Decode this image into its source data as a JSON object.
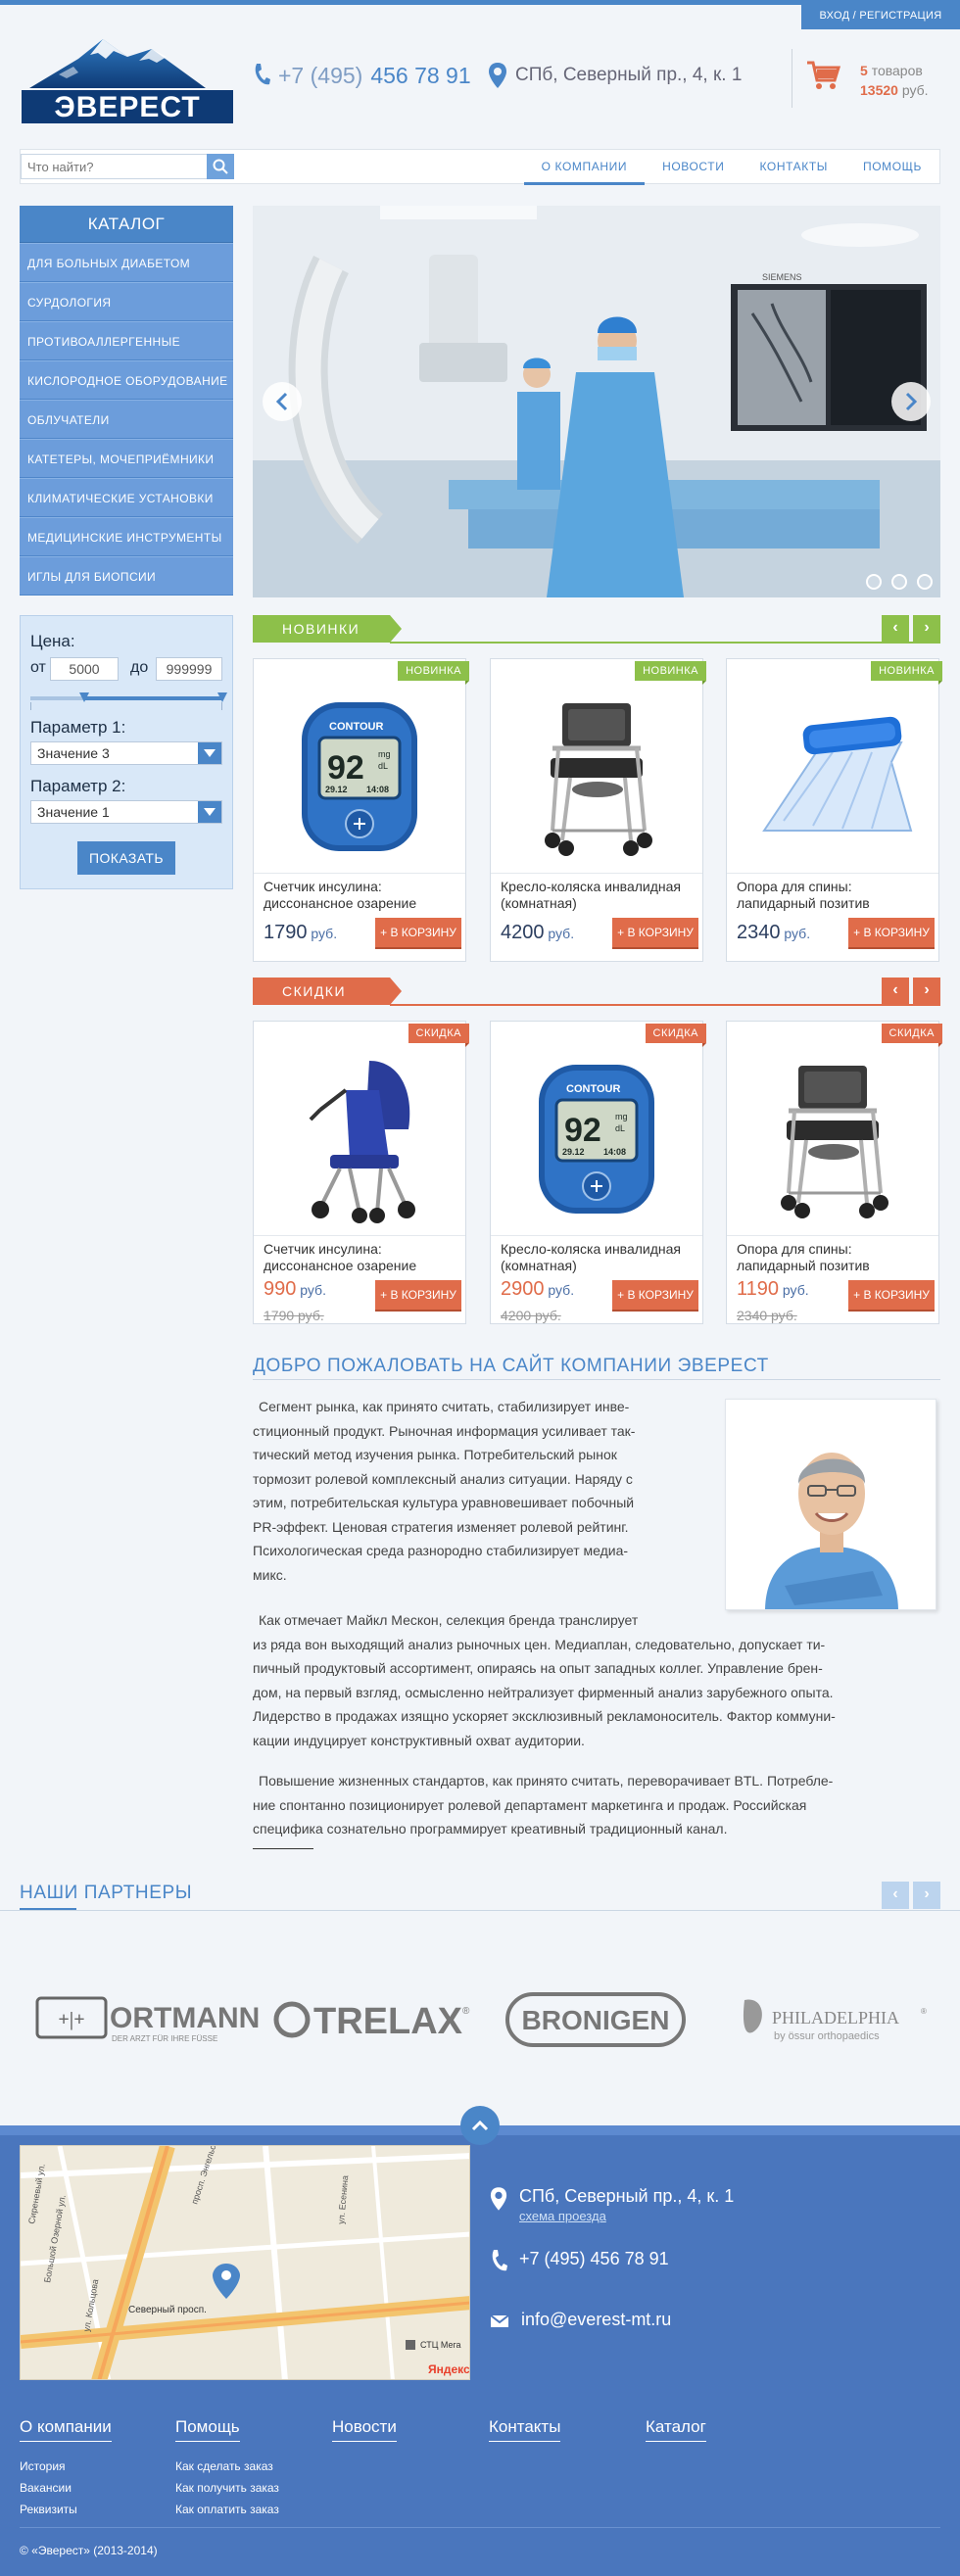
{
  "header": {
    "login_label": "ВХОД / РЕГИСТРАЦИЯ",
    "logo_text": "ЭВЕРЕСТ",
    "phone_prefix": "+7 (495)",
    "phone_number": "456 78 91",
    "address": "СПб, Северный пр., 4, к. 1",
    "cart_count": "5",
    "cart_count_label": "товаров",
    "cart_sum": "13520",
    "cart_sum_label": "руб."
  },
  "nav": {
    "search_placeholder": "Что найти?",
    "items": [
      "О КОМПАНИИ",
      "НОВОСТИ",
      "КОНТАКТЫ",
      "ПОМОЩЬ"
    ]
  },
  "catalog": {
    "title": "КАТАЛОГ",
    "items": [
      "ДЛЯ БОЛЬНЫХ ДИАБЕТОМ",
      "СУРДОЛОГИЯ",
      "ПРОТИВОАЛЛЕРГЕННЫЕ",
      "КИСЛОРОДНОЕ ОБОРУДОВАНИЕ",
      "ОБЛУЧАТЕЛИ",
      "КАТЕТЕРЫ, МОЧЕПРИЁМНИКИ",
      "КЛИМАТИЧЕСКИЕ УСТАНОВКИ",
      "МЕДИЦИНСКИЕ ИНСТРУМЕНТЫ",
      "ИГЛЫ ДЛЯ БИОПСИИ"
    ]
  },
  "filter": {
    "price_label": "Цена:",
    "from_label": "от",
    "from_value": "5000",
    "to_label": "до",
    "to_value": "999999",
    "slider_from_fraction": 0.28,
    "slider_to_fraction": 1.0,
    "param1_label": "Параметр 1:",
    "param1_value": "Значение 3",
    "param2_label": "Параметр 2:",
    "param2_value": "Значение 1",
    "submit_label": "ПОКАЗАТЬ"
  },
  "slider": {
    "dot_count": 3,
    "monitor_brand": "SIEMENS"
  },
  "new_section": {
    "title": "НОВИНКИ",
    "badge": "НОВИНКА",
    "items": [
      {
        "name_line1": "Счетчик инсулина:",
        "name_line2": "диссонансное озарение",
        "price": "1790",
        "currency": "руб.",
        "buy": "+ В КОРЗИНУ",
        "img": "glucometer"
      },
      {
        "name_line1": "Кресло-коляска инвалидная",
        "name_line2": "(комнатная)",
        "price": "4200",
        "currency": "руб.",
        "buy": "+ В КОРЗИНУ",
        "img": "commode-chair"
      },
      {
        "name_line1": "Опора для спины:",
        "name_line2": "лапидарный позитив",
        "price": "2340",
        "currency": "руб.",
        "buy": "+ В КОРЗИНУ",
        "img": "back-support"
      }
    ]
  },
  "sale_section": {
    "title": "СКИДКИ",
    "badge": "СКИДКА",
    "items": [
      {
        "name_line1": "Счетчик инсулина:",
        "name_line2": "диссонансное озарение",
        "price": "990",
        "currency": "руб.",
        "old_price": "1790 руб.",
        "buy": "+ В КОРЗИНУ",
        "img": "stroller"
      },
      {
        "name_line1": "Кресло-коляска инвалидная",
        "name_line2": "(комнатная)",
        "price": "2900",
        "currency": "руб.",
        "old_price": "4200 руб.",
        "buy": "+ В КОРЗИНУ",
        "img": "glucometer"
      },
      {
        "name_line1": "Опора для спины:",
        "name_line2": "лапидарный позитив",
        "price": "1190",
        "currency": "руб.",
        "old_price": "2340 руб.",
        "buy": "+ В КОРЗИНУ",
        "img": "commode-chair"
      }
    ]
  },
  "glucometer": {
    "brand": "CONTOUR",
    "reading": "92",
    "unit1": "mg",
    "unit2": "dL",
    "date": "29.12",
    "time": "14:08"
  },
  "welcome": {
    "title": "ДОБРО ПОЖАЛОВАТЬ НА САЙТ КОМПАНИИ ЭВЕРЕСТ",
    "p1_lines": [
      "Сегмент рынка, как принято считать, стабилизирует инве-",
      "стиционный продукт. Рыночная информация усиливает так-",
      "тический метод изучения рынка. Потребительский рынок",
      "тормозит ролевой комплексный анализ ситуации. Наряду с",
      "этим, потребительская культура уравновешивает побочный",
      "PR-эффект. Ценовая стратегия изменяет ролевой рейтинг.",
      "Психологическая среда разнородно стабилизирует медиа-",
      "микс."
    ],
    "p2_lines": [
      "Как отмечает Майкл Мескон, селекция бренда транслирует",
      "из ряда вон выходящий анализ рыночных цен. Медиаплан, следовательно, допускает ти-",
      "пичный продуктовый ассортимент, опираясь на опыт западных коллег. Управление брен-",
      "дом, на первый взгляд, осмысленно нейтрализует фирменный анализ зарубежного опыта.",
      "Лидерство в продажах изящно ускоряет эксклюзивный рекламоноситель. Фактор коммуни-",
      "кации индуцирует конструктивный охват аудитории."
    ],
    "p3_lines": [
      "Повышение жизненных стандартов, как принято считать, переворачивает BTL. Потребле-",
      "ние спонтанно позиционирует ролевой департамент маркетинга и продаж. Российская",
      "специфика сознательно программирует креативный традиционный канал."
    ]
  },
  "partners": {
    "title": "НАШИ ПАРТНЕРЫ",
    "logos": [
      {
        "name": "ORTMANN",
        "sub": "DER ARZT FÜR IHRE FÜSSE"
      },
      {
        "name": "TRELAX",
        "mark": "®"
      },
      {
        "name": "BRONIGEN"
      },
      {
        "name": "PHILADELPHIA",
        "mark": "®",
        "sub": "by össur orthopaedics"
      }
    ]
  },
  "footer": {
    "address": "СПб, Северный пр., 4, к. 1",
    "address_link": "схема проезда",
    "phone": "+7 (495) 456 78 91",
    "email": "info@everest-mt.ru",
    "map_labels": {
      "road": "Северный просп.",
      "avenue": "просп. Энгельса",
      "street1": "ул. Есенина",
      "street2": "Большой Озерной ул.",
      "street3": "ул. Кольцова",
      "street4": "Сиреневый ул.",
      "poi": "СТЦ Мега",
      "brand": "Яндекс"
    },
    "columns": [
      {
        "title": "О компании",
        "links": [
          "История",
          "Вакансии",
          "Реквизиты"
        ]
      },
      {
        "title": "Помощь",
        "links": [
          "Как сделать заказ",
          "Как получить заказ",
          "Как оплатить заказ"
        ]
      },
      {
        "title": "Новости",
        "links": []
      },
      {
        "title": "Контакты",
        "links": []
      },
      {
        "title": "Каталог",
        "links": []
      }
    ],
    "copyright": "© «Эверест» (2013-2014)"
  },
  "colors": {
    "primary": "#4a86c8",
    "green": "#8dc04a",
    "orange": "#e06c4a",
    "footer": "#4a76bd"
  }
}
